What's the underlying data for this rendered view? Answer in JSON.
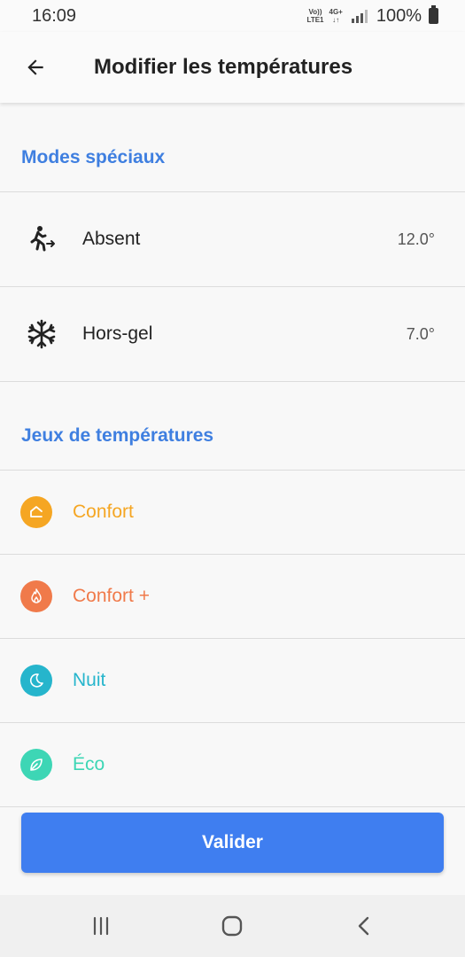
{
  "status_bar": {
    "time": "16:09",
    "volte": "Vo))",
    "lte": "LTE1",
    "network": "4G+",
    "battery": "100%"
  },
  "app_bar": {
    "title": "Modifier les températures"
  },
  "special_modes": {
    "header": "Modes spéciaux",
    "items": [
      {
        "label": "Absent",
        "value": "12.0°",
        "icon": "walking-away-icon"
      },
      {
        "label": "Hors-gel",
        "value": "7.0°",
        "icon": "snowflake-icon"
      }
    ]
  },
  "temperature_sets": {
    "header": "Jeux de températures",
    "items": [
      {
        "label": "Confort",
        "color": "#f5a623",
        "icon": "home-icon"
      },
      {
        "label": "Confort +",
        "color": "#f07a4a",
        "icon": "flame-icon"
      },
      {
        "label": "Nuit",
        "color": "#26b5cc",
        "icon": "moon-icon"
      },
      {
        "label": "Éco",
        "color": "#3dd6b5",
        "icon": "leaf-icon"
      }
    ]
  },
  "actions": {
    "validate_label": "Valider"
  },
  "colors": {
    "accent": "#3f7fe0",
    "button": "#3f7ef0"
  }
}
